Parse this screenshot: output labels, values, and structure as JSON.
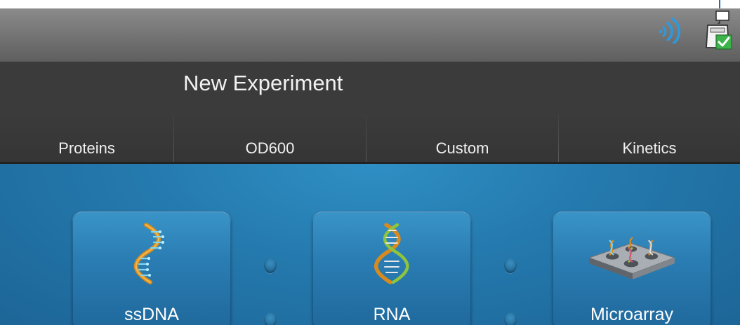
{
  "status_bar": {
    "icons": [
      "wifi-icon",
      "device-connected-icon"
    ],
    "wifi_color": "#2b9ae0",
    "check_color": "#3cb34a"
  },
  "header": {
    "title": "New Experiment"
  },
  "tabs": [
    {
      "label": "Proteins"
    },
    {
      "label": "OD600"
    },
    {
      "label": "Custom"
    },
    {
      "label": "Kinetics"
    }
  ],
  "tiles": [
    {
      "label": "ssDNA",
      "icon": "dna-helix-icon"
    },
    {
      "label": "RNA",
      "icon": "rna-helix-icon"
    },
    {
      "label": "Microarray",
      "icon": "microarray-icon"
    }
  ],
  "colors": {
    "status_bar": "#767676",
    "title_bar": "#3b3b3b",
    "content_bg": "#2479ad",
    "tile_bg": "#2a7db3"
  }
}
